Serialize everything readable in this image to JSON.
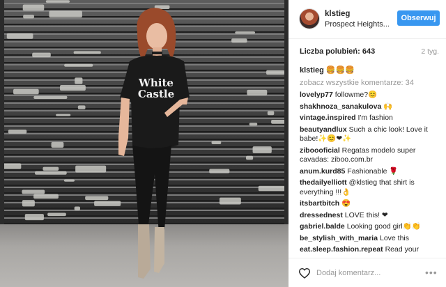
{
  "post": {
    "username": "klstieg",
    "location": "Prospect Heights...",
    "follow_label": "Obserwuj",
    "likes_label": "Liczba polubień: 643",
    "time_ago": "2 tyg.",
    "caption_user": "klstieg",
    "caption_text": "🍔🍔🍔",
    "shirt_text_line1": "White",
    "shirt_text_line2": "Castle"
  },
  "comments": {
    "view_all_label": "zobacz wszystkie komentarze: 34",
    "items": [
      {
        "user": "lovelyp77",
        "text": "followme?😊"
      },
      {
        "user": "shakhnoza_sanakulova",
        "text": "🙌"
      },
      {
        "user": "vintage.inspired",
        "text": "I'm fashion"
      },
      {
        "user": "beautyandlux",
        "text": "Such a chic look! Love it babe!✨😊❤✨"
      },
      {
        "user": "ziboooficial",
        "text": "Regatas modelo super cavadas: ziboo.com.br"
      },
      {
        "user": "anum.kurd85",
        "text": "Fashionable 🌹"
      },
      {
        "user": "thedailyelliott",
        "text": "@klstieg that shirt is everything !!!👌"
      },
      {
        "user": "itsbartbitch",
        "text": "😍"
      },
      {
        "user": "dressednest",
        "text": "LOVE this! ❤"
      },
      {
        "user": "gabriel.balde",
        "text": "Looking good girl👏👏"
      },
      {
        "user": "be_stylish_with_maria",
        "text": "Love this"
      },
      {
        "user": "eat.sleep.fashion.repeat",
        "text": "Read your"
      }
    ]
  },
  "footer": {
    "comment_placeholder": "Dodaj komentarz...",
    "more_symbol": "•••"
  },
  "icons": {
    "like": "heart-outline-icon",
    "more": "more-options-icon",
    "avatar": "user-avatar"
  },
  "colors": {
    "accent": "#3897f0",
    "muted": "#999999",
    "text": "#262626"
  }
}
